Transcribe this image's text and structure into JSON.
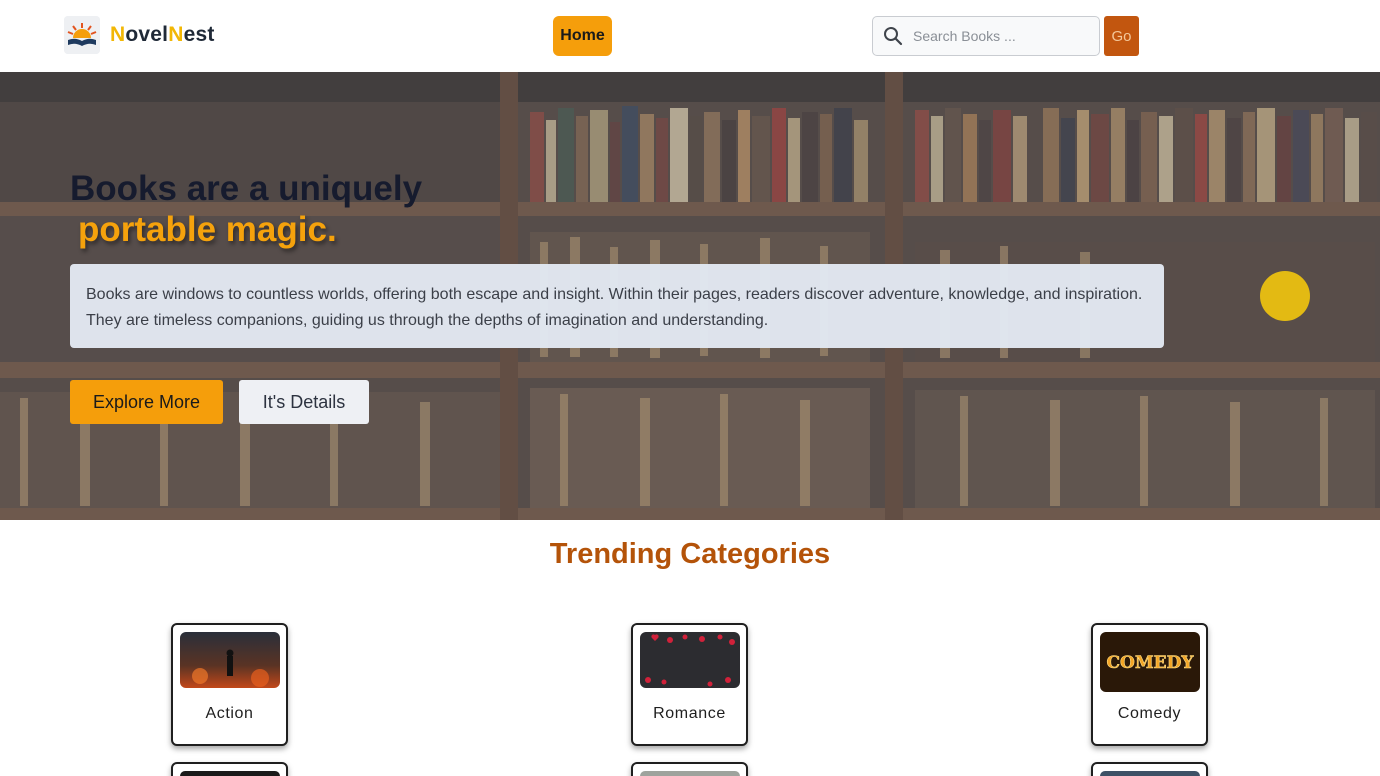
{
  "navbar": {
    "brand": {
      "first_letter": "N",
      "part1": "ovel",
      "second_letter": "N",
      "part2": "est",
      "logo_icon": "sunrise-book-logo"
    },
    "home_label": "Home",
    "search": {
      "placeholder": "Search Books ...",
      "value": "",
      "icon": "search-icon"
    },
    "go_label": "Go"
  },
  "hero": {
    "title_line1": "Books are a uniquely",
    "title_line2": "portable magic.",
    "description": "Books are windows to countless worlds, offering both escape and insight. Within their pages, readers discover adventure, knowledge, and inspiration. They are timeless companions, guiding us through the depths of imagination and understanding.",
    "explore_label": "Explore More",
    "details_label": "It's Details"
  },
  "categories": {
    "title": "Trending Categories",
    "items": [
      {
        "label": "Action"
      },
      {
        "label": "Romance"
      },
      {
        "label": "Comedy"
      }
    ]
  },
  "colors": {
    "accent": "#f59e0b",
    "go_button": "#c2560f",
    "section_title": "#b45309",
    "brand_highlight": "#f2b705"
  }
}
